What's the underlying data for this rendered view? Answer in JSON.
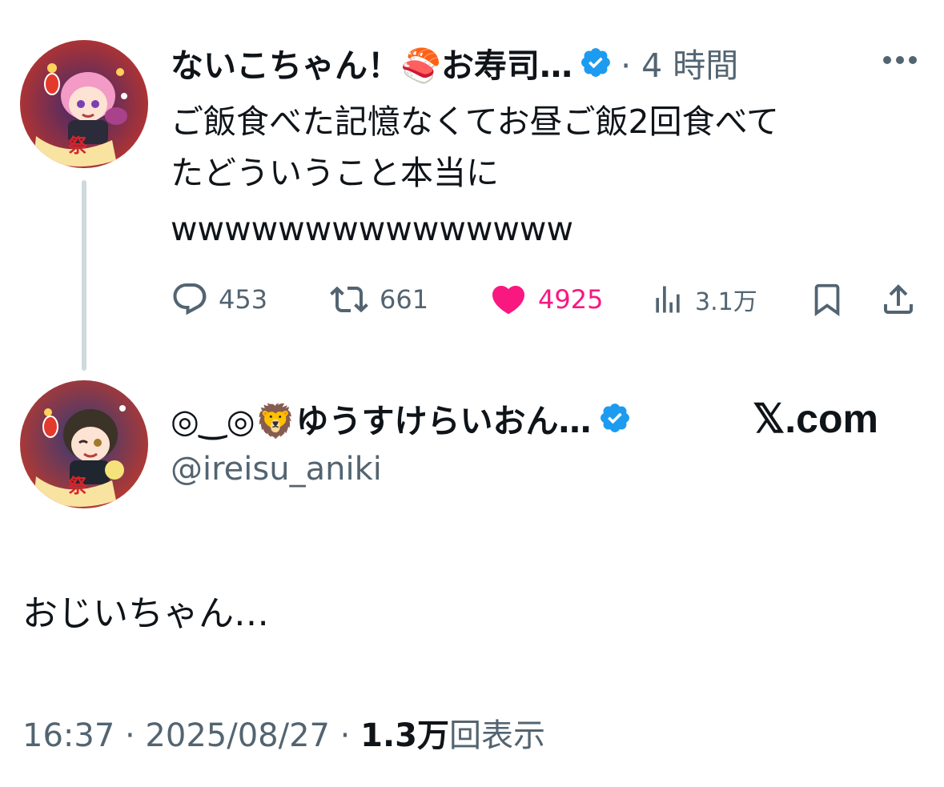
{
  "tweet1": {
    "display_name": "ないこちゃん！🍣お寿司…",
    "time": "· 4 時間",
    "text_line1": "ご飯食べた記憶なくてお昼ご飯2回食べて",
    "text_line2": "たどういうこと本当に",
    "text_line3": "wwwwwwwwwwwwwww",
    "actions": {
      "reply_count": "453",
      "retweet_count": "661",
      "like_count": "4925",
      "views_count": "3.1万"
    },
    "like_color": "#f91880"
  },
  "tweet2": {
    "display_name": "◎‿◎🦁ゆうすけらいおん…",
    "handle": "@ireisu_aniki",
    "source_badge": "𝕏.com",
    "text": "おじいちゃん…",
    "time_line": "16:37 · 2025/08/27 · ",
    "views_value": "1.3万",
    "views_label": "回表示"
  },
  "icons": [
    "more-icon",
    "verified-badge-icon",
    "reply-icon",
    "retweet-icon",
    "like-icon",
    "views-icon",
    "bookmark-icon",
    "share-icon"
  ],
  "colors": {
    "verified": "#1d9bf0",
    "muted": "#536471",
    "text": "#0f1419"
  }
}
